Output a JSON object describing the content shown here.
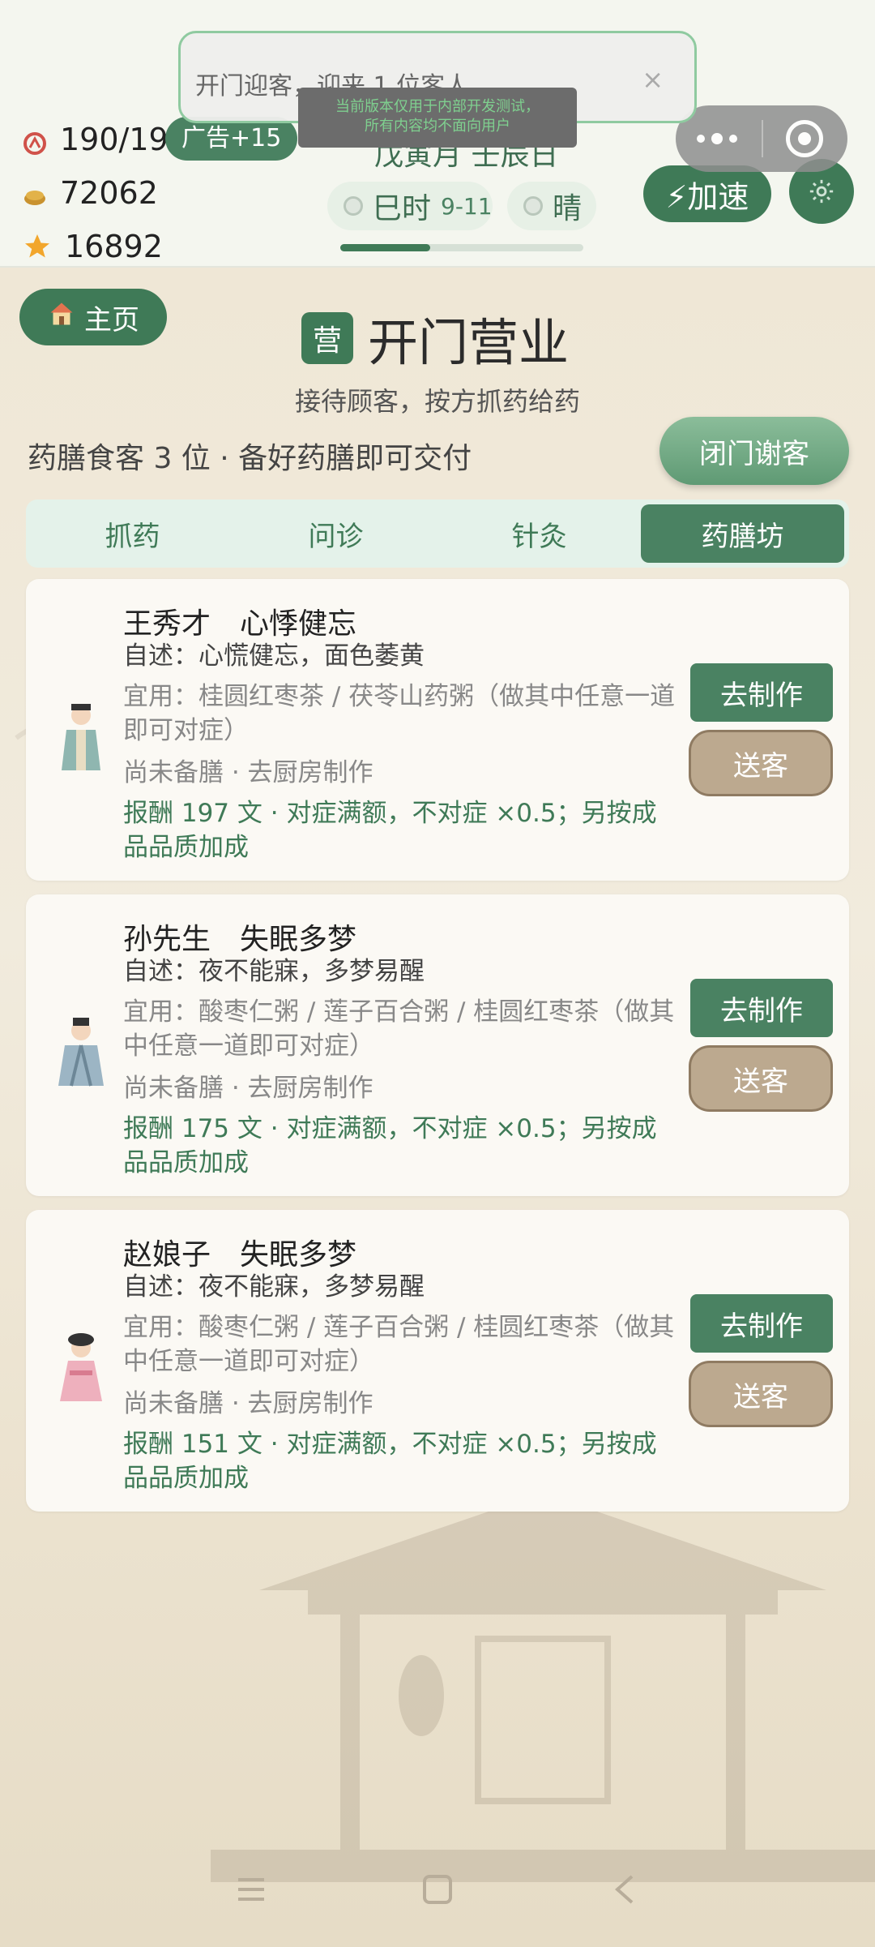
{
  "toast": {
    "message": "开门迎客，迎来 1 位客人",
    "close": "×"
  },
  "dev_tip": {
    "line1": "当前版本仅用于内部开发测试，",
    "line2": "所有内容均不面向用户"
  },
  "resources": {
    "stamina": "190/190",
    "coins": "72062",
    "stars": "16892"
  },
  "ad_button": "广告+15",
  "date": "戊寅月 壬辰日",
  "time": {
    "label": "巳时",
    "range": "9-11"
  },
  "weather": "晴",
  "day_progress": 0.37,
  "speed_button": "⚡加速",
  "home_button": "主页",
  "page": {
    "badge": "营",
    "title": "开门营业",
    "subtitle": "接待顾客，按方抓药给药"
  },
  "status_line": "药膳食客 3 位 · 备好药膳即可交付",
  "close_shop_button": "闭门谢客",
  "tabs": [
    {
      "label": "抓药",
      "active": false
    },
    {
      "label": "问诊",
      "active": false
    },
    {
      "label": "针灸",
      "active": false
    },
    {
      "label": "药膳坊",
      "active": true
    }
  ],
  "customers": [
    {
      "name": "王秀才　心悸健忘",
      "self_report": "自述：心慌健忘，面色萎黄",
      "suitable": "宜用：桂圆红枣茶 / 茯苓山药粥（做其中任意一道即可对症）",
      "state": "尚未备膳 · 去厨房制作",
      "reward": "报酬 197 文 · 对症满额，不对症 ×0.5；另按成品品质加成",
      "make_label": "去制作",
      "send_label": "送客"
    },
    {
      "name": "孙先生　失眠多梦",
      "self_report": "自述：夜不能寐，多梦易醒",
      "suitable": "宜用：酸枣仁粥 / 莲子百合粥 / 桂圆红枣茶（做其中任意一道即可对症）",
      "state": "尚未备膳 · 去厨房制作",
      "reward": "报酬 175 文 · 对症满额，不对症 ×0.5；另按成品品质加成",
      "make_label": "去制作",
      "send_label": "送客"
    },
    {
      "name": "赵娘子　失眠多梦",
      "self_report": "自述：夜不能寐，多梦易醒",
      "suitable": "宜用：酸枣仁粥 / 莲子百合粥 / 桂圆红枣茶（做其中任意一道即可对症）",
      "state": "尚未备膳 · 去厨房制作",
      "reward": "报酬 151 文 · 对症满额，不对症 ×0.5；另按成品品质加成",
      "make_label": "去制作",
      "send_label": "送客"
    }
  ],
  "colors": {
    "primary": "#3f7a57",
    "tab_bg": "#e4f2ea",
    "send_btn": "#bca98f",
    "reward_text": "#3f7a57"
  }
}
